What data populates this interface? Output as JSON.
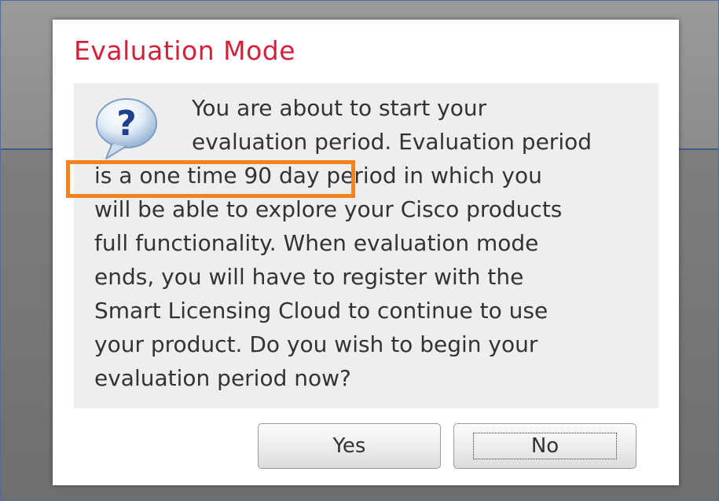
{
  "dialog": {
    "title": "Evaluation Mode",
    "title_color": "#d61f3a",
    "icon": "question-icon",
    "message_lines": [
      "You are about to start your",
      "evaluation period. Evaluation period",
      "is a one time 90 day period in which you",
      "will be able to explore your Cisco products",
      "full functionality. When evaluation mode",
      "ends, you will have to register with the",
      "Smart Licensing Cloud to continue to use",
      "your product. Do you wish to begin your",
      "evaluation period now?"
    ],
    "highlight_color": "#f58220"
  },
  "buttons": {
    "yes_label": "Yes",
    "no_label": "No"
  }
}
